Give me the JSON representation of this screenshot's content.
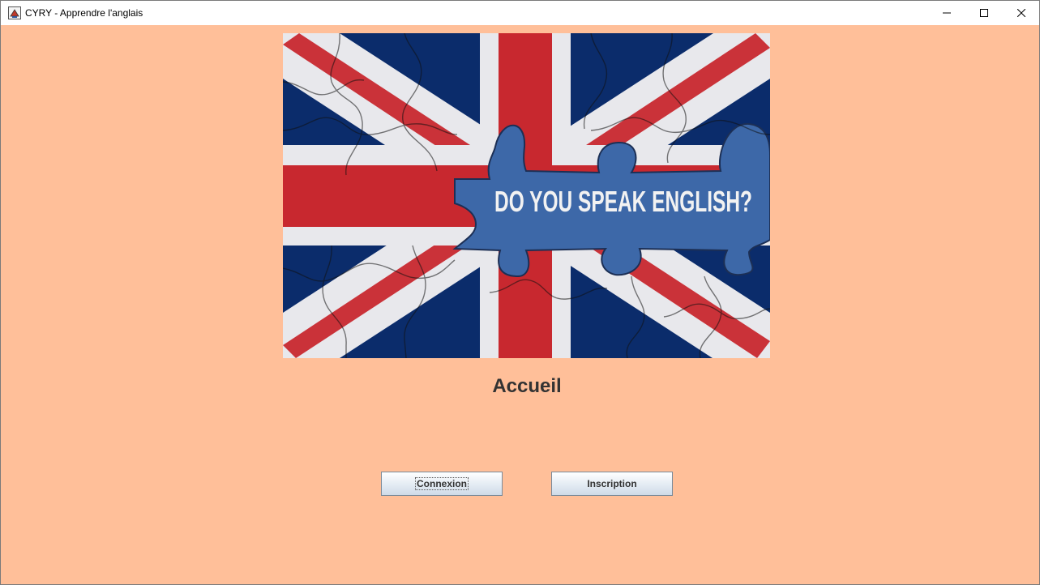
{
  "window": {
    "title": "CYRY - Apprendre l'anglais",
    "background": "#ffbf99"
  },
  "hero": {
    "caption": "DO YOU SPEAK ENGLISH?",
    "flag_colors": {
      "blue": "#0b2c6b",
      "red": "#c8282f",
      "white": "#e8e8ec",
      "panel_blue": "#3d68a8"
    }
  },
  "main": {
    "heading": "Accueil"
  },
  "buttons": {
    "connexion": "Connexion",
    "inscription": "Inscription"
  }
}
